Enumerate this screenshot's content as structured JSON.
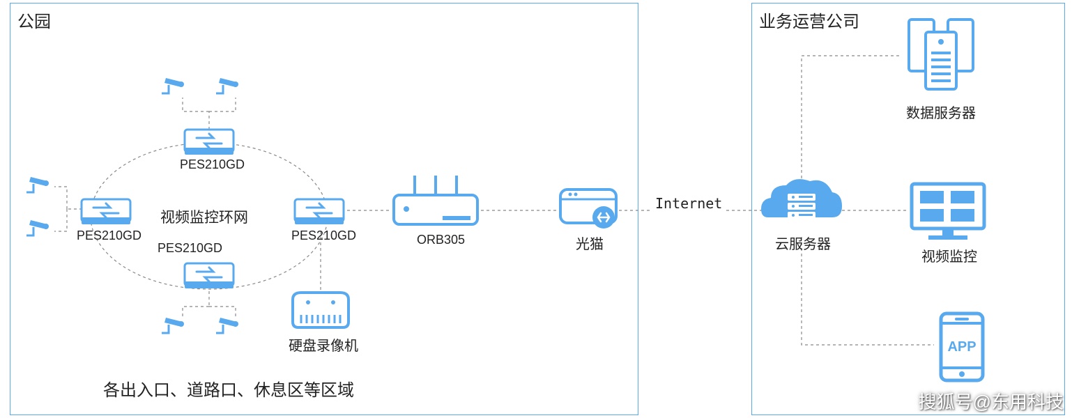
{
  "diagram": {
    "leftBox": {
      "title": "公园"
    },
    "rightBox": {
      "title": "业务运营公司"
    },
    "nodes": {
      "switchTop": {
        "label": "PES210GD"
      },
      "switchLeft": {
        "label": "PES210GD"
      },
      "switchRight": {
        "label": "PES210GD"
      },
      "switchBottom": {
        "label": "PES210GD"
      },
      "ringLabel": "视频监控环网",
      "router": {
        "label": "ORB305"
      },
      "nvr": {
        "label": "硬盘录像机"
      },
      "opticalModem": {
        "label": "光猫"
      },
      "cloud": {
        "label": "云服务器"
      },
      "servers": {
        "label": "数据服务器"
      },
      "monitor": {
        "label": "视频监控"
      },
      "app": {
        "label": "APP"
      }
    },
    "connections": {
      "internet": "Internet"
    },
    "footnote": "各出入口、道路口、休息区等区域",
    "watermark": "搜狐号@东用科技"
  },
  "colors": {
    "accent": "#58a9ed"
  }
}
